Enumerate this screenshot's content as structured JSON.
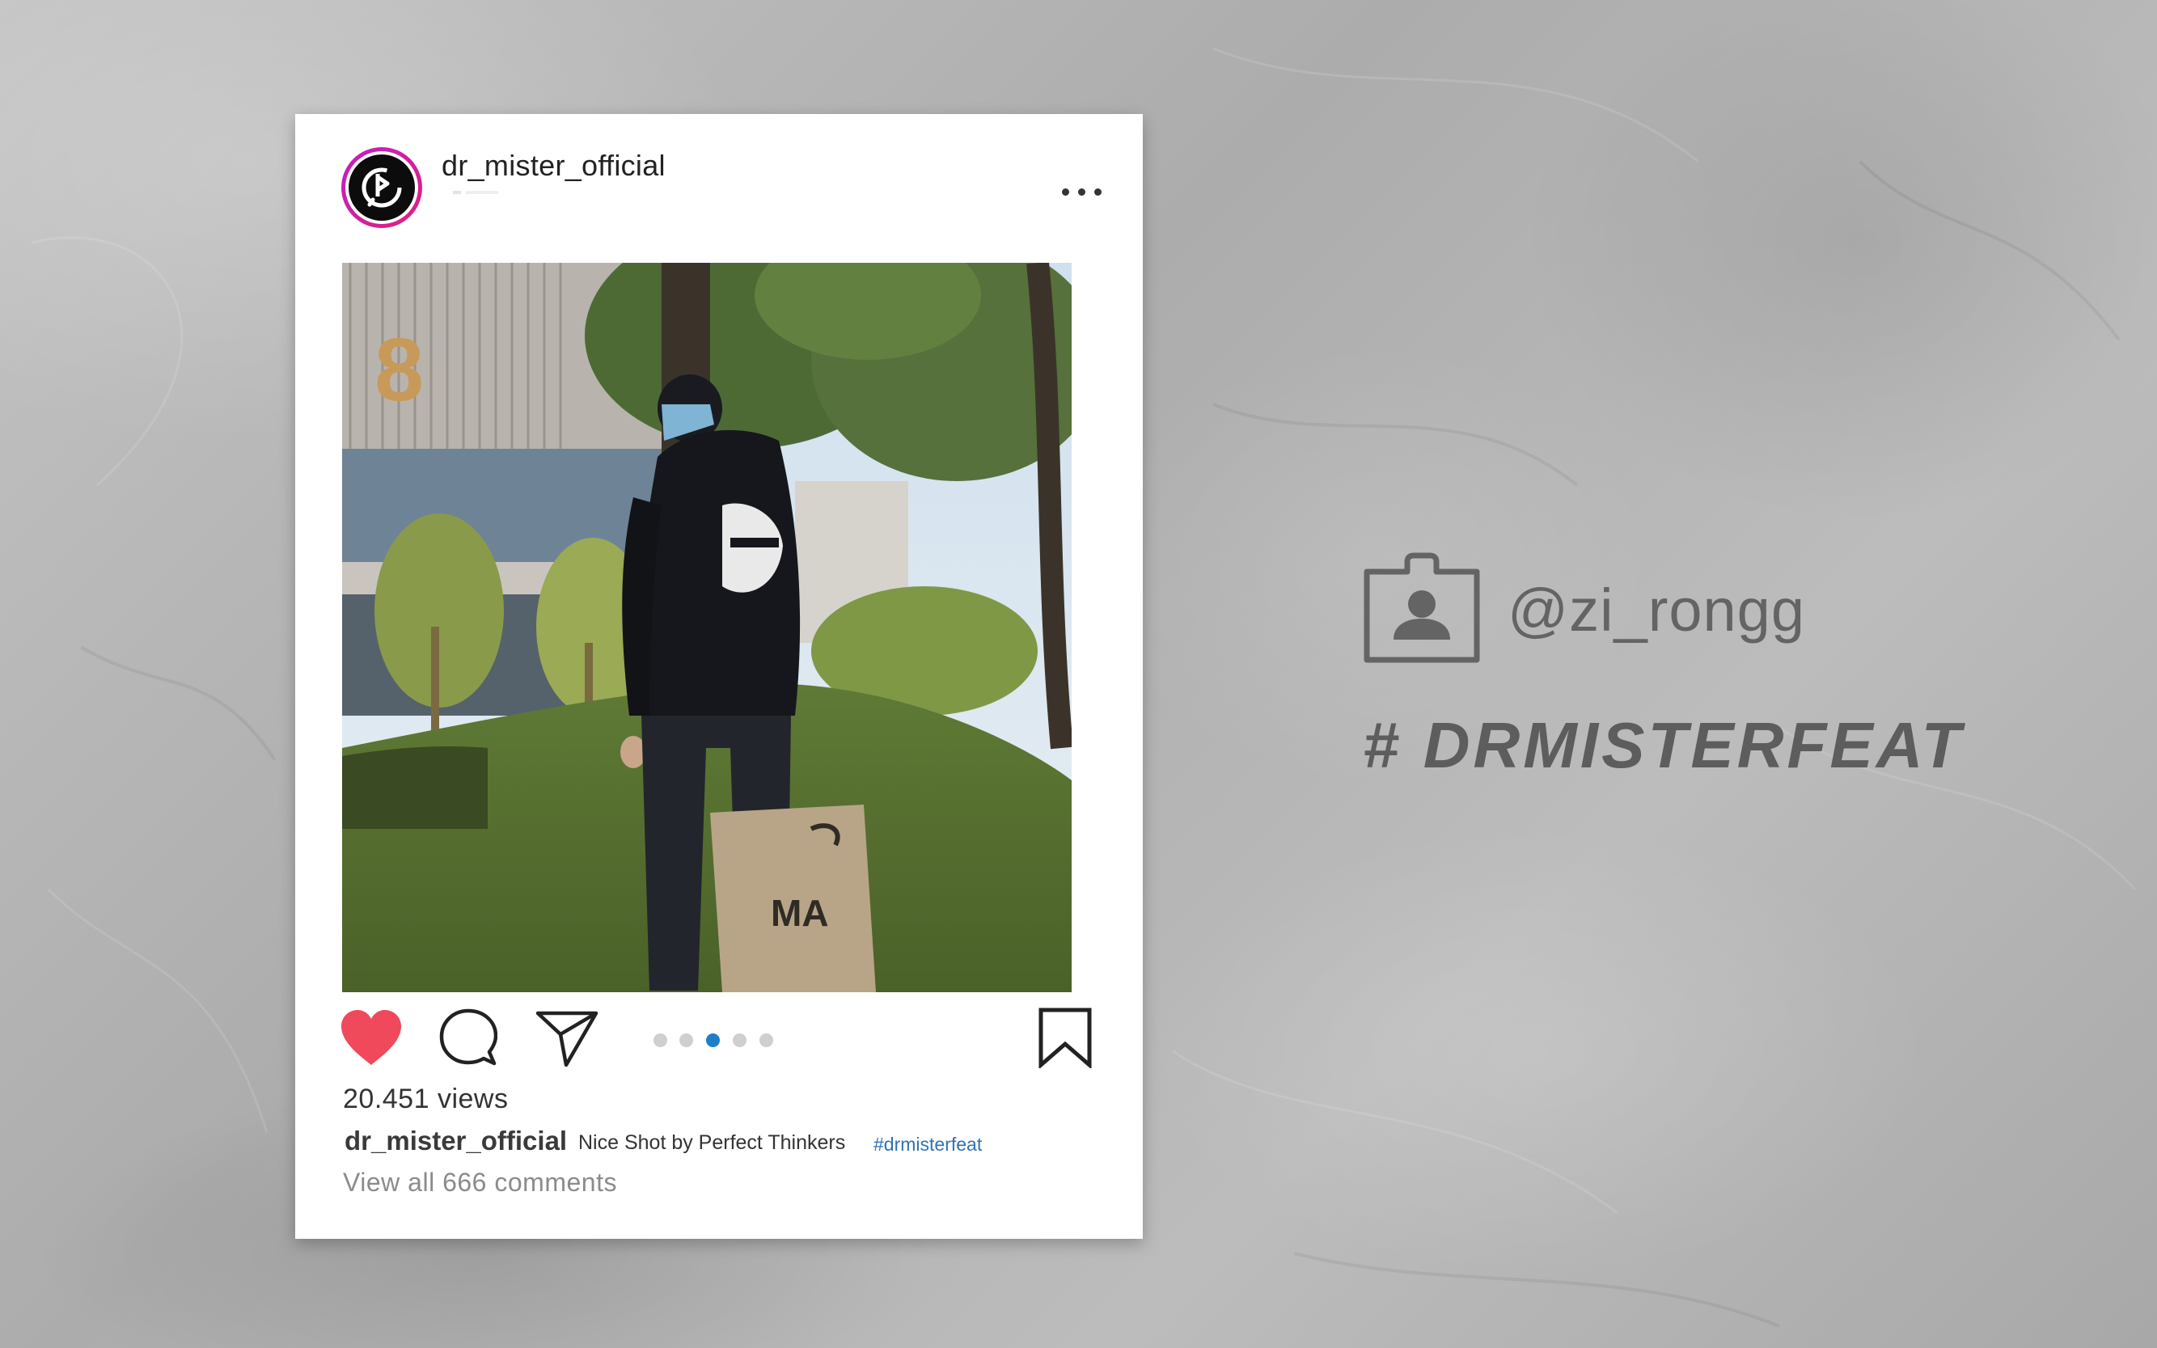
{
  "post": {
    "username": "dr_mister_official",
    "views": "20.451 views",
    "caption": {
      "username": "dr_mister_official",
      "text": "Nice Shot by Perfect Thinkers",
      "hashtag": "#drmisterfeat"
    },
    "view_comments": "View all 666 comments",
    "carousel": {
      "count": 5,
      "active_index": 2
    },
    "liked": true,
    "icons": {
      "like": "heart-icon",
      "comment": "comment-icon",
      "share": "send-icon",
      "save": "bookmark-icon",
      "more": "more-options-icon"
    }
  },
  "credit": {
    "handle": "@zi_rongg",
    "hashtag": "# DRMISTERFEAT",
    "icon": "id-badge-icon"
  },
  "colors": {
    "like_red": "#f0495b",
    "dot_active": "#1f7ec8",
    "hashtag_blue": "#2f72b5",
    "story_ring": "#c21fc7"
  }
}
